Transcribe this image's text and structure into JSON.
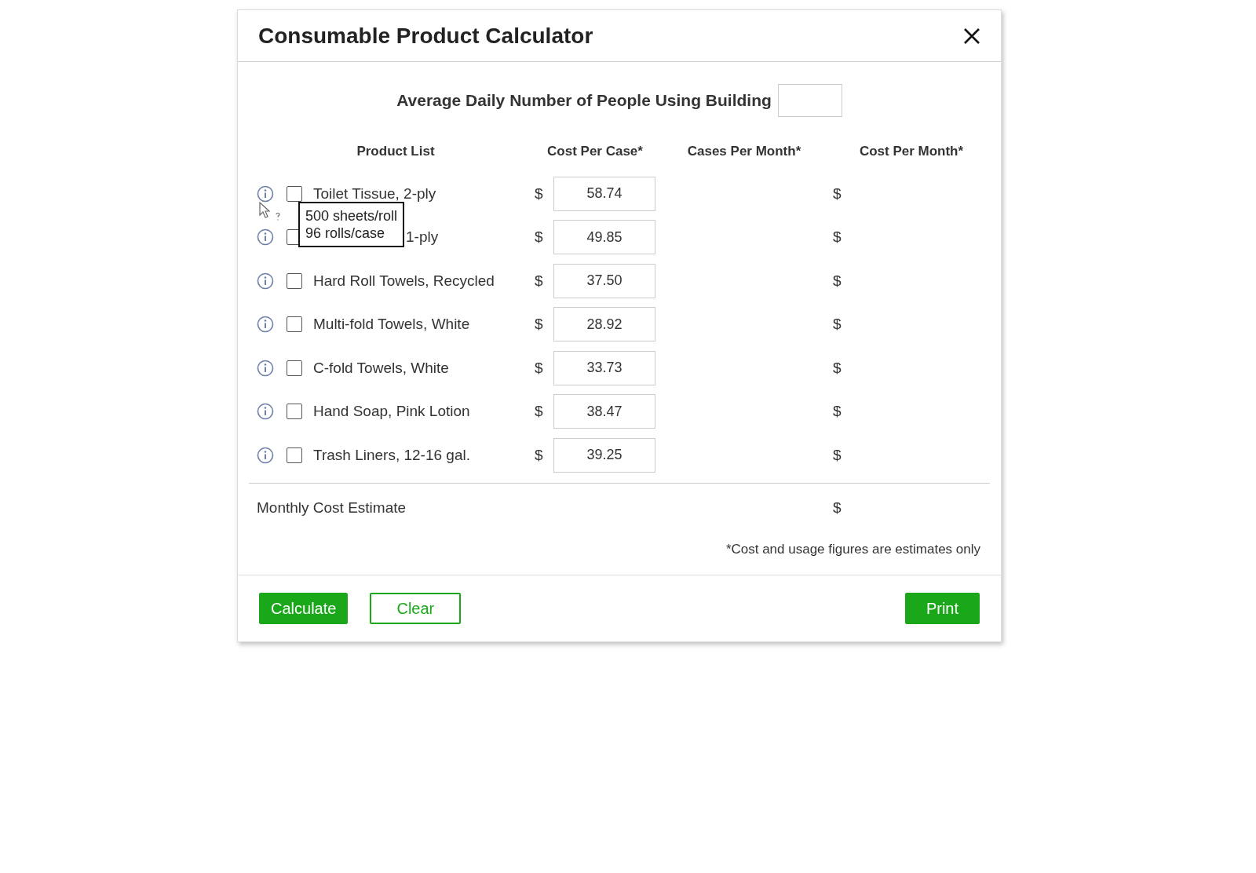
{
  "dialog": {
    "title": "Consumable Product Calculator"
  },
  "people_field": {
    "label": "Average Daily Number of People Using Building"
  },
  "table": {
    "columns": [
      "Product List",
      "Cost Per Case*",
      "Cases Per Month*",
      "Cost Per Month*"
    ],
    "rows": [
      {
        "name": "Toilet Tissue, 2-ply",
        "checked": false,
        "currency": "$",
        "cost": "58.74",
        "total_currency": "$"
      },
      {
        "name": "1-ply",
        "checked": false,
        "currency": "$",
        "cost": "49.85",
        "total_currency": "$"
      },
      {
        "name": "Hard Roll Towels, Recycled",
        "checked": false,
        "currency": "$",
        "cost": "37.50",
        "total_currency": "$"
      },
      {
        "name": "Multi-fold Towels, White",
        "checked": false,
        "currency": "$",
        "cost": "28.92",
        "total_currency": "$"
      },
      {
        "name": "C-fold Towels, White",
        "checked": false,
        "currency": "$",
        "cost": "33.73",
        "total_currency": "$"
      },
      {
        "name": "Hand Soap, Pink Lotion",
        "checked": false,
        "currency": "$",
        "cost": "38.47",
        "total_currency": "$"
      },
      {
        "name": "Trash Liners, 12-16 gal.",
        "checked": false,
        "currency": "$",
        "cost": "39.25",
        "total_currency": "$"
      }
    ]
  },
  "tooltip": {
    "lines": [
      "500 sheets/roll",
      "96 rolls/case"
    ]
  },
  "summary": {
    "label": "Monthly Cost Estimate",
    "currency": "$"
  },
  "footnote": "*Cost and usage figures are estimates only",
  "buttons": [
    {
      "label": "Calculate",
      "kind": "primary"
    },
    {
      "label": "Clear",
      "kind": "outline"
    },
    {
      "label": "Print",
      "kind": "primary"
    }
  ]
}
